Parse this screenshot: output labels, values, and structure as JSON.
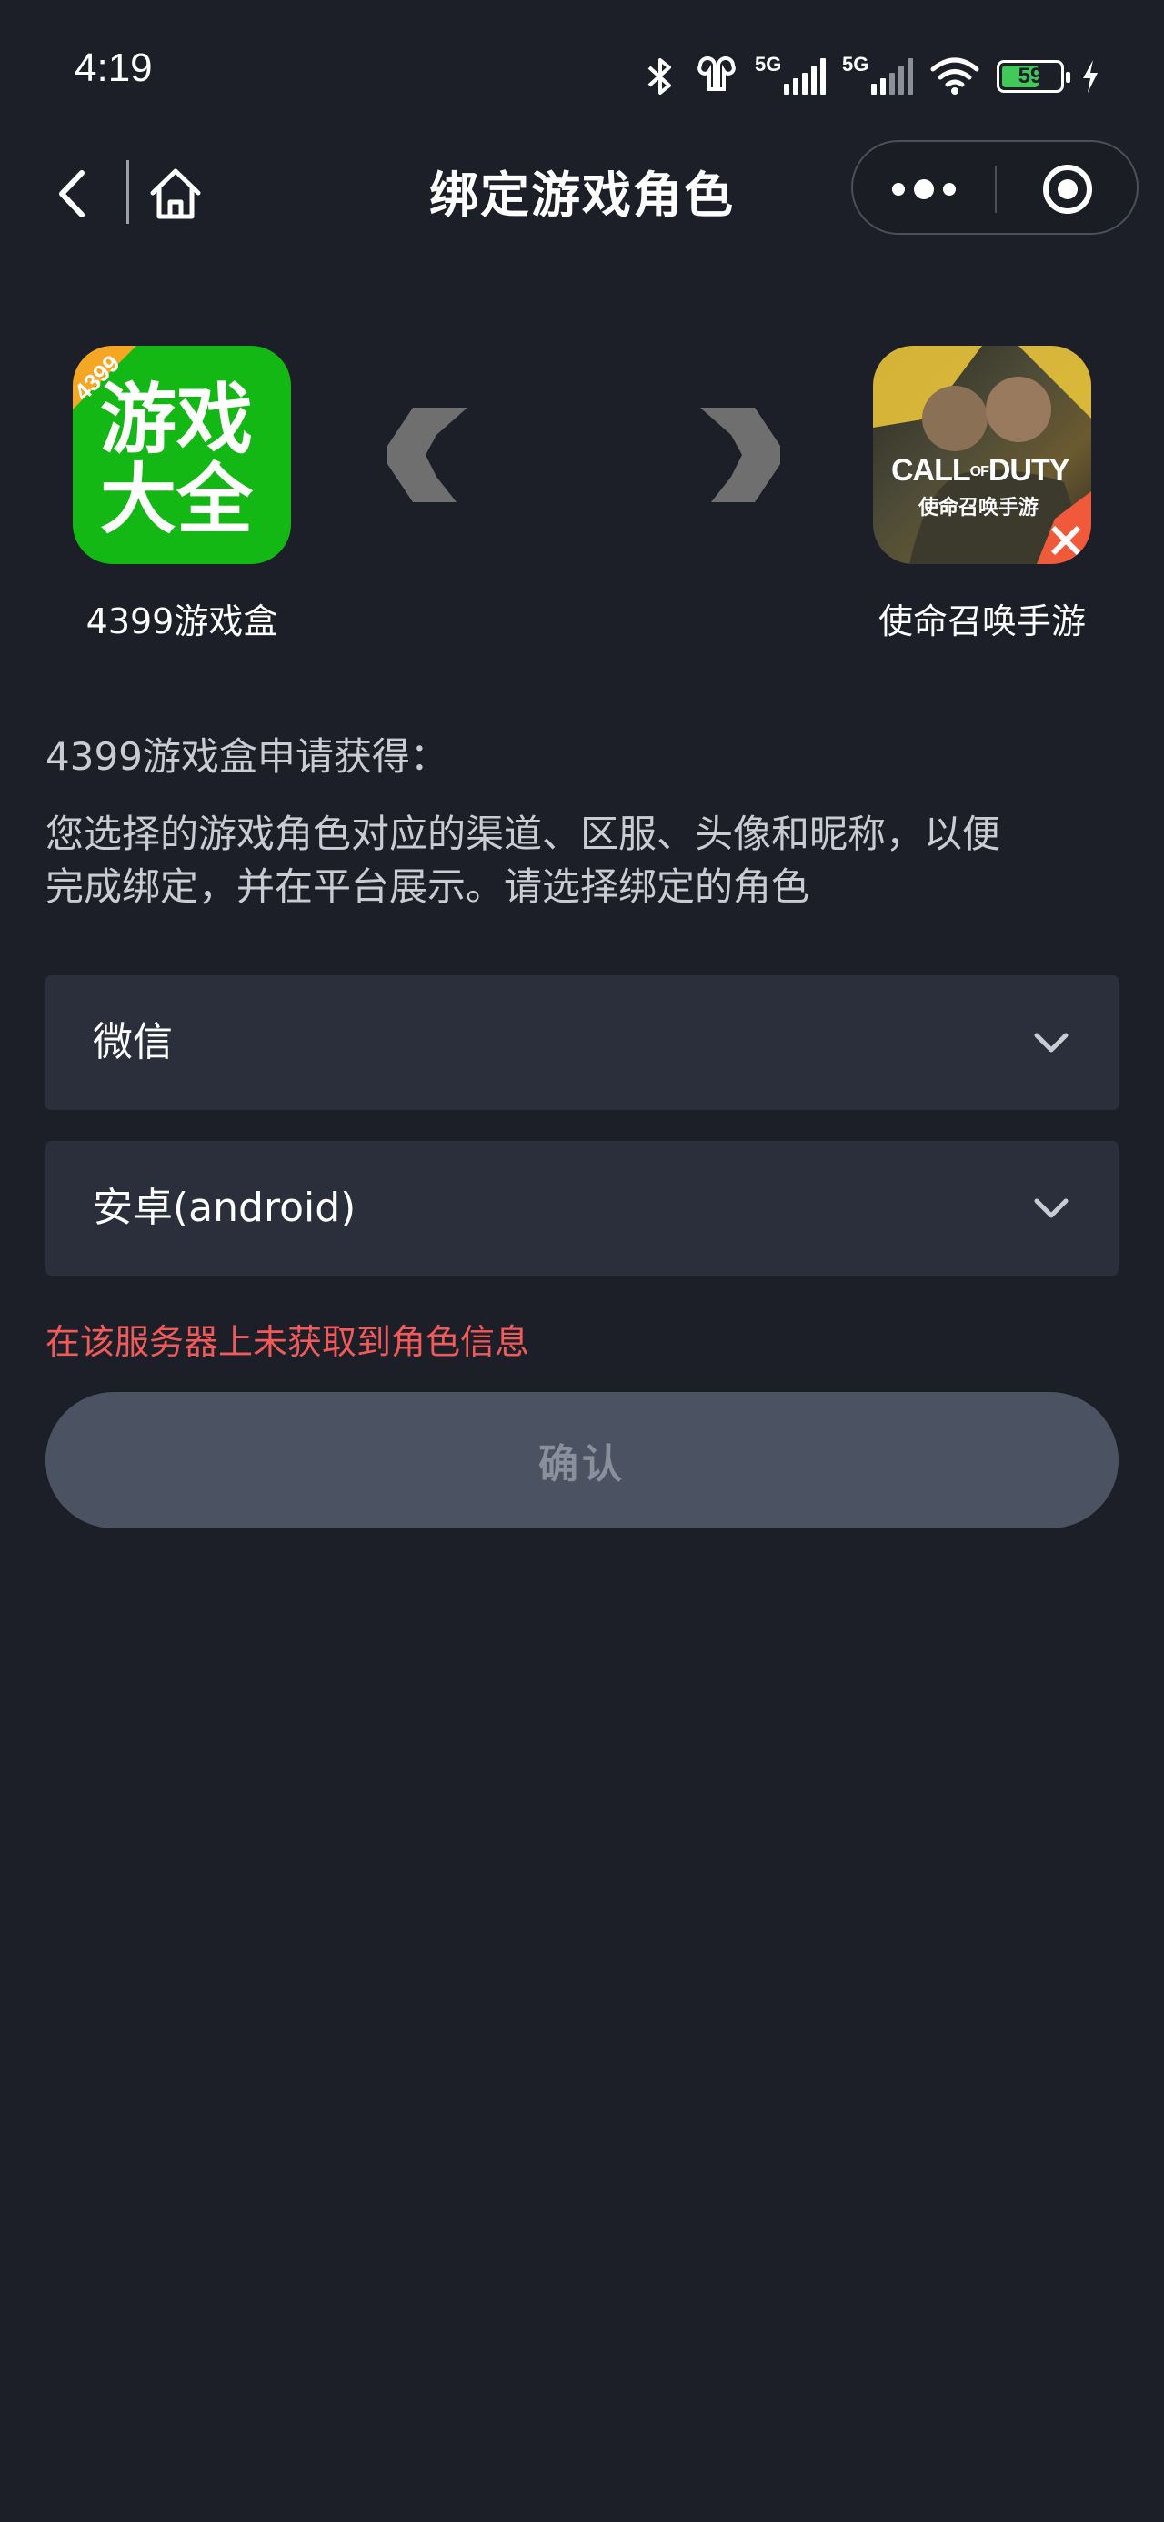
{
  "status_bar": {
    "time": "4:19",
    "network_1": "5G",
    "network_2": "5G",
    "battery": "59",
    "icons": [
      "bluetooth-icon",
      "earbuds-icon",
      "signal-icon",
      "signal-icon",
      "wifi-icon",
      "battery-icon",
      "charging-icon"
    ]
  },
  "nav": {
    "title": "绑定游戏角色",
    "icons": [
      "back-arrow-icon",
      "home-icon",
      "more-dots-icon",
      "close-circle-icon"
    ]
  },
  "apps": {
    "source": {
      "name": "4399游戏盒",
      "badge": "4399",
      "icon_line1": "游戏",
      "icon_line2": "大全",
      "color": "#14b814"
    },
    "target": {
      "name": "使命召唤手游",
      "icon_line1": "CALL",
      "icon_of": "OF",
      "icon_line1b": "DUTY",
      "icon_line2": "使命召唤手游"
    }
  },
  "request": {
    "title": "4399游戏盒申请获得：",
    "description_line1": "您选择的游戏角色对应的渠道、区服、头像和昵称，以便",
    "description_line2": "完成绑定，并在平台展示。请选择绑定的角色"
  },
  "selects": {
    "channel": "微信",
    "platform": "安卓(android)"
  },
  "error": "在该服务器上未获取到角色信息",
  "confirm_label": "确认",
  "colors": {
    "background": "#1c1f28",
    "select_bg": "#2a2f3b",
    "error": "#f25a5a",
    "confirm_bg": "#4b5362"
  }
}
